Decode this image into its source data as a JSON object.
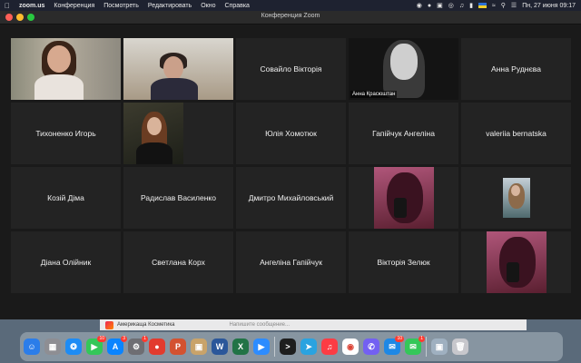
{
  "menubar": {
    "app": "zoom.us",
    "menus": [
      "Конференция",
      "Посмотреть",
      "Редактировать",
      "Окно",
      "Справка"
    ],
    "clock": "Пн, 27 июня 09:17"
  },
  "window": {
    "title": "Конференция Zoom"
  },
  "participants": {
    "r1c3": "Совайло Вікторія",
    "r1c4_caption": "Анна Красюштан",
    "r1c5": "Анна Руднєва",
    "r2c1": "Тихоненко Игорь",
    "r2c3": "Юлія Хомотюк",
    "r2c4": "Гапійчук Ангеліна",
    "r2c5": "valeriia bernatska",
    "r3c1": "Козій Діма",
    "r3c2": "Радислав Василенко",
    "r3c3": "Дмитро Михайловський",
    "r4c1": "Діана Олійник",
    "r4c2": "Светлана Корх",
    "r4c3": "Ангеліна Гапійчук",
    "r4c4": "Вікторія Зелюк"
  },
  "behind_window": {
    "title": "Америкаща Косметика",
    "placeholder": "Напишите сообщение..."
  },
  "dock": {
    "badges": {
      "facetime": "10",
      "appstore": "3",
      "settings": "1",
      "mail": "10",
      "messages": "1"
    }
  },
  "colors": {
    "active_speaker": "#d8e24a",
    "tile_bg": "#232323",
    "window_bg": "#1a1a1a"
  }
}
